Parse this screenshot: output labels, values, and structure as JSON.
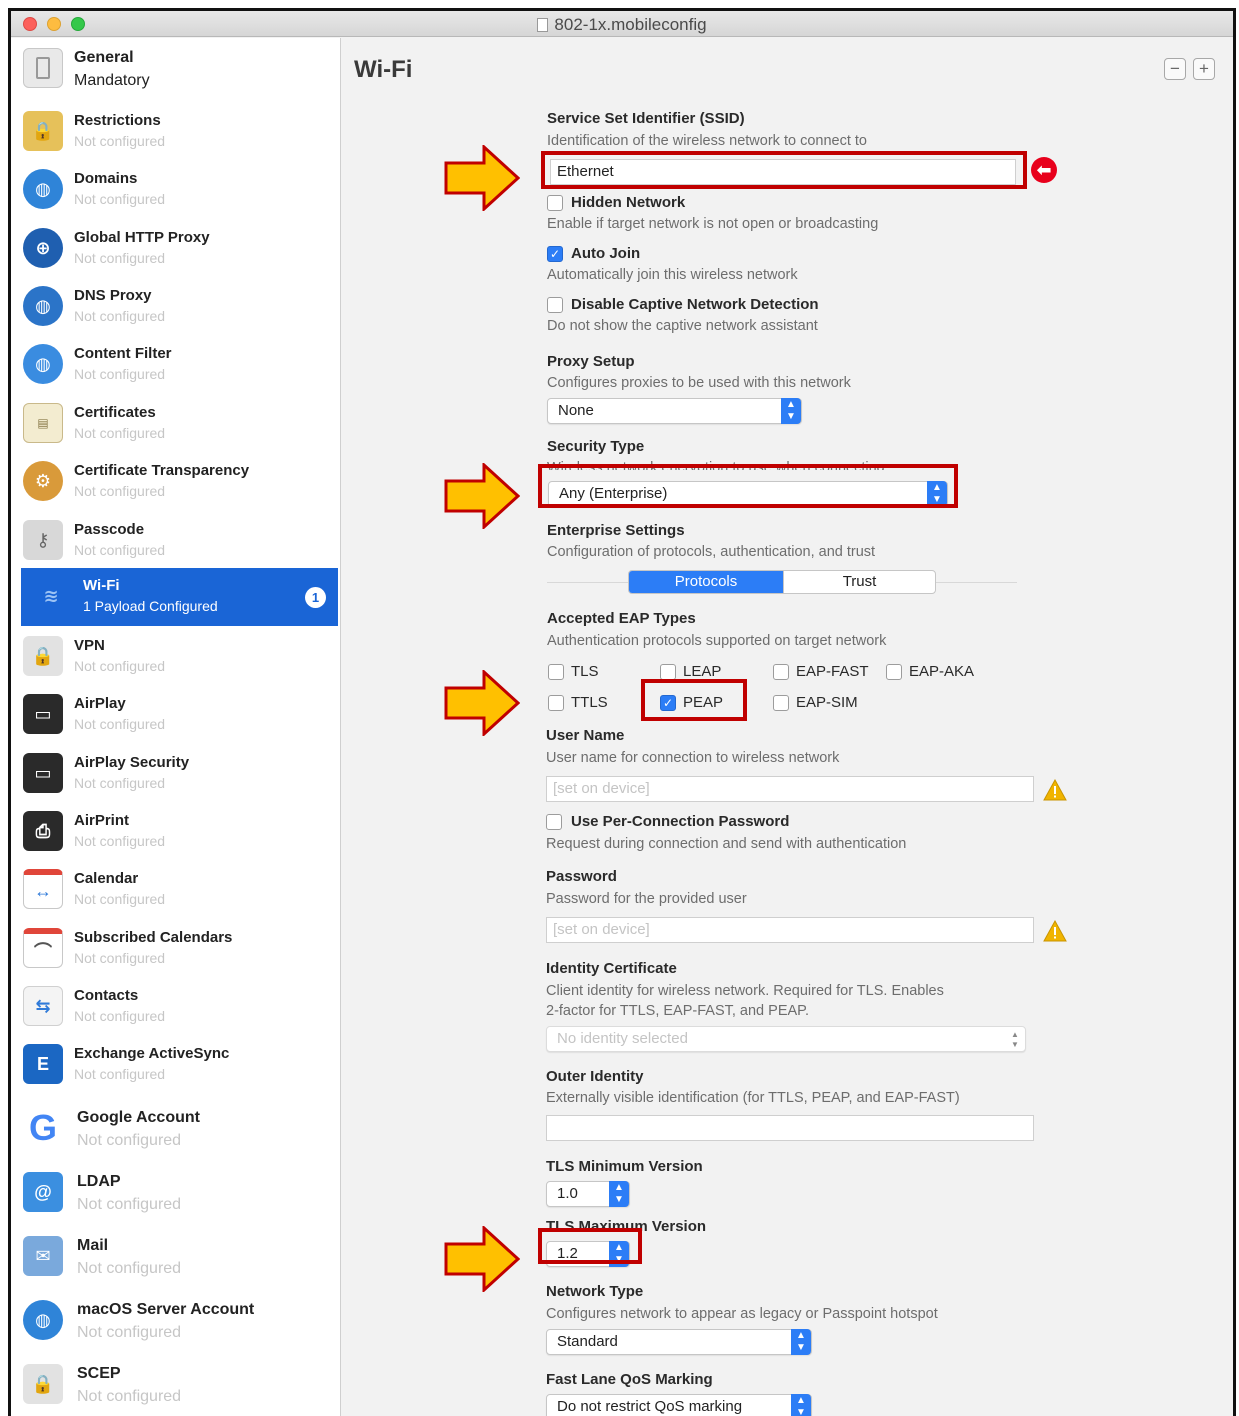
{
  "window": {
    "title": "802-1x.mobileconfig"
  },
  "sidebar": {
    "items": [
      {
        "name": "General",
        "sub": "Mandatory"
      },
      {
        "name": "Restrictions",
        "sub": "Not configured"
      },
      {
        "name": "Domains",
        "sub": "Not configured"
      },
      {
        "name": "Global HTTP Proxy",
        "sub": "Not configured"
      },
      {
        "name": "DNS Proxy",
        "sub": "Not configured"
      },
      {
        "name": "Content Filter",
        "sub": "Not configured"
      },
      {
        "name": "Certificates",
        "sub": "Not configured"
      },
      {
        "name": "Certificate Transparency",
        "sub": "Not configured"
      },
      {
        "name": "Passcode",
        "sub": "Not configured"
      },
      {
        "name": "Wi-Fi",
        "sub": "1 Payload Configured",
        "badge": "1"
      },
      {
        "name": "VPN",
        "sub": "Not configured"
      },
      {
        "name": "AirPlay",
        "sub": "Not configured"
      },
      {
        "name": "AirPlay Security",
        "sub": "Not configured"
      },
      {
        "name": "AirPrint",
        "sub": "Not configured"
      },
      {
        "name": "Calendar",
        "sub": "Not configured"
      },
      {
        "name": "Subscribed Calendars",
        "sub": "Not configured"
      },
      {
        "name": "Contacts",
        "sub": "Not configured"
      },
      {
        "name": "Exchange ActiveSync",
        "sub": "Not configured"
      },
      {
        "name": "Google Account",
        "sub": "Not configured"
      },
      {
        "name": "LDAP",
        "sub": "Not configured"
      },
      {
        "name": "Mail",
        "sub": "Not configured"
      },
      {
        "name": "macOS Server Account",
        "sub": "Not configured"
      },
      {
        "name": "SCEP",
        "sub": "Not configured"
      }
    ]
  },
  "main": {
    "title": "Wi-Fi",
    "minus": "−",
    "plus": "+",
    "ssid": {
      "label": "Service Set Identifier (SSID)",
      "desc": "Identification of the wireless network to connect to",
      "value": "Ethernet"
    },
    "hidden_network": {
      "label": "Hidden Network",
      "desc": "Enable if target network is not open or broadcasting",
      "checked": false
    },
    "auto_join": {
      "label": "Auto Join",
      "desc": "Automatically join this wireless network",
      "checked": true
    },
    "captive": {
      "label": "Disable Captive Network Detection",
      "desc": "Do not show the captive network assistant",
      "checked": false
    },
    "proxy": {
      "label": "Proxy Setup",
      "desc": "Configures proxies to be used with this network",
      "value": "None"
    },
    "security": {
      "label": "Security Type",
      "desc": "Wireless network encryption to use when connecting",
      "value": "Any (Enterprise)"
    },
    "enterprise": {
      "label": "Enterprise Settings",
      "desc": "Configuration of protocols, authentication, and trust",
      "tabs": [
        "Protocols",
        "Trust"
      ]
    },
    "eap": {
      "label": "Accepted EAP Types",
      "desc": "Authentication protocols supported on target network",
      "types": [
        {
          "name": "TLS",
          "checked": false
        },
        {
          "name": "LEAP",
          "checked": false
        },
        {
          "name": "EAP-FAST",
          "checked": false
        },
        {
          "name": "EAP-AKA",
          "checked": false
        },
        {
          "name": "TTLS",
          "checked": false
        },
        {
          "name": "PEAP",
          "checked": true
        },
        {
          "name": "EAP-SIM",
          "checked": false
        }
      ]
    },
    "username": {
      "label": "User Name",
      "desc": "User name for connection to wireless network",
      "placeholder": "[set on device]"
    },
    "per_conn": {
      "label": "Use Per-Connection Password",
      "desc": "Request during connection and send with authentication",
      "checked": false
    },
    "password": {
      "label": "Password",
      "desc": "Password for the provided user",
      "placeholder": "[set on device]"
    },
    "identity_cert": {
      "label": "Identity Certificate",
      "desc1": "Client identity for wireless network. Required for TLS. Enables",
      "desc2": "2-factor for TTLS, EAP-FAST, and PEAP.",
      "value": "No identity selected"
    },
    "outer_identity": {
      "label": "Outer Identity",
      "desc": "Externally visible identification (for TTLS, PEAP, and EAP-FAST)",
      "value": ""
    },
    "tls_min": {
      "label": "TLS Minimum Version",
      "value": "1.0"
    },
    "tls_max": {
      "label": "TLS Maximum Version",
      "value": "1.2"
    },
    "network_type": {
      "label": "Network Type",
      "desc": "Configures network to appear as legacy or Passpoint hotspot",
      "value": "Standard"
    },
    "qos": {
      "label": "Fast Lane QoS Marking",
      "value": "Do not restrict QoS marking"
    }
  },
  "annotations": {
    "highlight_color": "#c00000",
    "arrow_color": "#ffc000"
  }
}
